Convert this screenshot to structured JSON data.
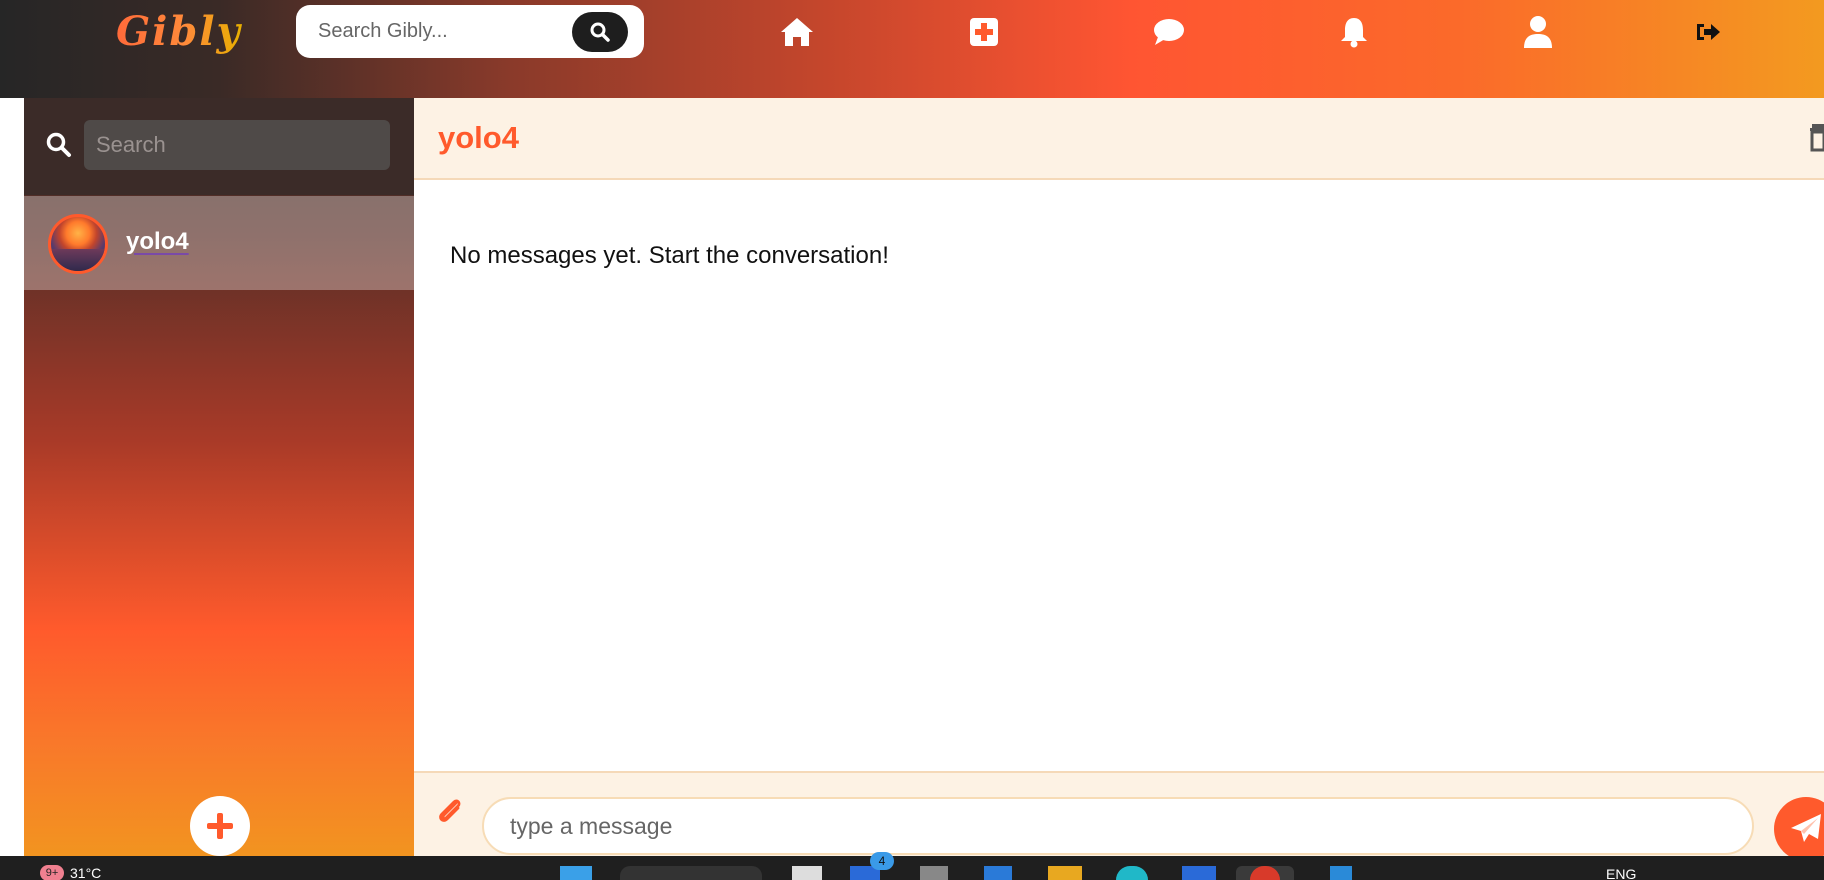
{
  "app": {
    "logo": "Gibly"
  },
  "topnav": {
    "search_placeholder": "Search Gibly...",
    "icons": [
      "home-icon",
      "plus-square-icon",
      "chat-bubble-icon",
      "bell-icon",
      "user-icon",
      "sign-out-icon"
    ]
  },
  "sidebar": {
    "search_placeholder": "Search",
    "conversations": [
      {
        "name": "yolo4"
      }
    ]
  },
  "chat": {
    "title": "yolo4",
    "empty_text": "No messages yet. Start the conversation!",
    "input_placeholder": "type a message"
  },
  "taskbar": {
    "notification_badge": "9+",
    "temperature": "31°C",
    "language": "ENG",
    "app_badge": "4"
  },
  "colors": {
    "accent": "#ff5a2c",
    "header_bg": "#fdf2e4",
    "sidebar_top": "#3b2b28",
    "taskbar": "#1f1f1f"
  }
}
